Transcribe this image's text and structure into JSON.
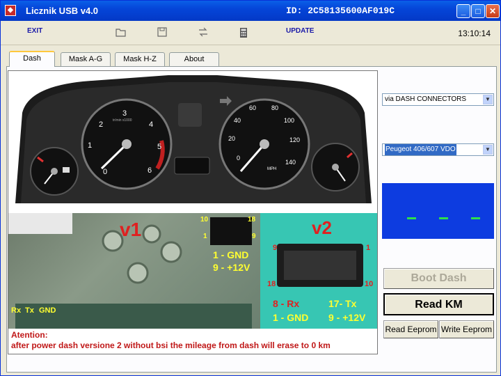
{
  "window": {
    "title": "Licznik USB  v4.0",
    "id_label": "ID:  2C58135600AF019C",
    "minimize_glyph": "_",
    "maximize_glyph": "□",
    "close_glyph": "✕"
  },
  "toolbar": {
    "exit_label": "EXIT",
    "update_label": "UPDATE",
    "clock": "13:10:14"
  },
  "tabs": [
    {
      "label": "Dash"
    },
    {
      "label": "Mask  A-G"
    },
    {
      "label": "Mask  H-Z"
    },
    {
      "label": "About"
    }
  ],
  "connection": {
    "selected": "via DASH CONNECTORS"
  },
  "model": {
    "selected": "Peugeot 406/607 VDO"
  },
  "buttons": {
    "boot_dash": "Boot Dash",
    "read_km": "Read  KM",
    "read_eeprom": "Read Eeprom",
    "write_eeprom": "Write Eeprom"
  },
  "photo": {
    "v1": "v1",
    "v2": "v2",
    "v1_pins": {
      "p10": "10",
      "p18": "18",
      "p1": "1",
      "p9": "9",
      "gnd": "1 - GND",
      "vcc": "9 - +12V",
      "rx": "Rx",
      "tx": "Tx",
      "gnd_pad": "GND"
    },
    "v2_pins": {
      "p9": "9",
      "p1": "1",
      "p18": "18",
      "p10": "10",
      "rx": "8 - Rx",
      "tx": "17- Tx",
      "gnd": "1 - GND",
      "vcc": "9 - +12V"
    },
    "tach_ticks": [
      "0",
      "1",
      "2",
      "3",
      "4",
      "5",
      "6"
    ],
    "speed_ticks": [
      "0",
      "20",
      "40",
      "60",
      "80",
      "100",
      "120",
      "140"
    ],
    "speed_unit": "MPH",
    "tach_unit": "tr/min x1000"
  },
  "notes": {
    "line1": "Atention:",
    "line2": "after power dash versione 2 without bsi the mileage from dash will erase to 0 km"
  },
  "colors": {
    "titlebar": "#0545d8",
    "display_bg": "#0d3ce0",
    "display_segments": "#2ee04a",
    "warning_text": "#c01818",
    "label_yellow": "#ffff30"
  }
}
